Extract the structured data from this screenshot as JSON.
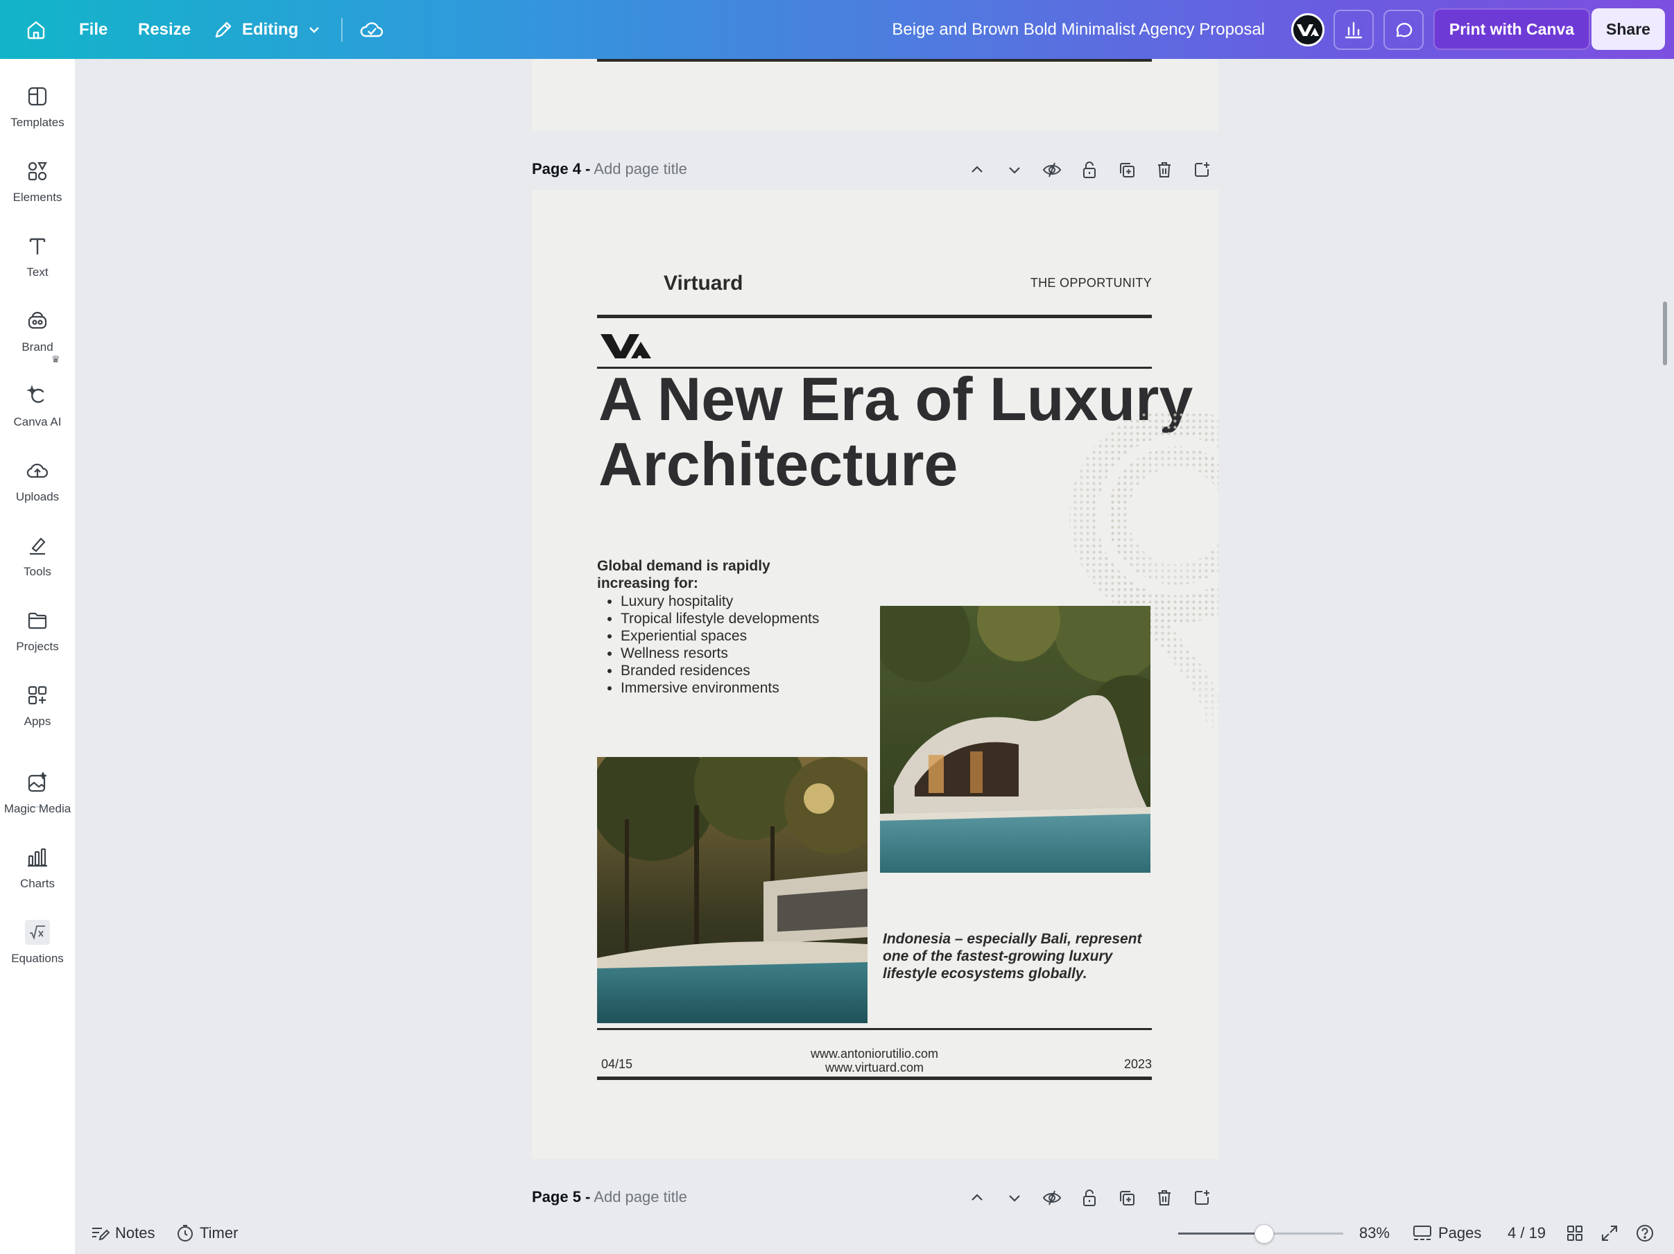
{
  "topbar": {
    "file_label": "File",
    "resize_label": "Resize",
    "editing_label": "Editing",
    "doc_title": "Beige and Brown Bold Minimalist Agency Proposal",
    "print_label": "Print with Canva",
    "share_label": "Share"
  },
  "sidebar": {
    "items": [
      {
        "label": "Templates",
        "icon": "templates-icon"
      },
      {
        "label": "Elements",
        "icon": "elements-icon"
      },
      {
        "label": "Text",
        "icon": "text-icon"
      },
      {
        "label": "Brand",
        "icon": "brand-icon"
      },
      {
        "label": "Canva AI",
        "icon": "canva-ai-icon"
      },
      {
        "label": "Uploads",
        "icon": "uploads-icon"
      },
      {
        "label": "Tools",
        "icon": "tools-icon"
      },
      {
        "label": "Projects",
        "icon": "projects-icon"
      },
      {
        "label": "Apps",
        "icon": "apps-icon"
      },
      {
        "label": "Magic Media",
        "icon": "magic-media-icon"
      },
      {
        "label": "Charts",
        "icon": "charts-icon"
      },
      {
        "label": "Equations",
        "icon": "equations-icon"
      }
    ]
  },
  "pages": {
    "page4_label": "Page 4 -",
    "page5_label": "Page 5 -",
    "add_title": "Add page title"
  },
  "slide": {
    "brand_name": "Virtuard",
    "section_tag": "THE OPPORTUNITY",
    "headline_line1": "A New Era of Luxury",
    "headline_line2": "Architecture",
    "lead": "Global demand is rapidly increasing for:",
    "bullets": [
      "Luxury hospitality",
      "Tropical lifestyle developments",
      "Experiential spaces",
      "Wellness resorts",
      "Branded residences",
      "Immersive environments"
    ],
    "quote": "Indonesia – especially Bali, represent one of the fastest-growing luxury lifestyle ecosystems globally.",
    "footer_page": "04/15",
    "footer_url1": "www.antoniorutilio.com",
    "footer_url2": "www.virtuard.com",
    "footer_year": "2023"
  },
  "bottombar": {
    "notes_label": "Notes",
    "timer_label": "Timer",
    "zoom_value": "83%",
    "zoom_fraction": 0.52,
    "pages_label": "Pages",
    "page_counter": "4 / 19"
  },
  "colors": {
    "accent_purple": "#6e3ad6",
    "gradient_start": "#12b5c9",
    "gradient_end": "#7d4fe0",
    "slide_bg": "#efefed",
    "slide_text": "#2b2b2b"
  }
}
